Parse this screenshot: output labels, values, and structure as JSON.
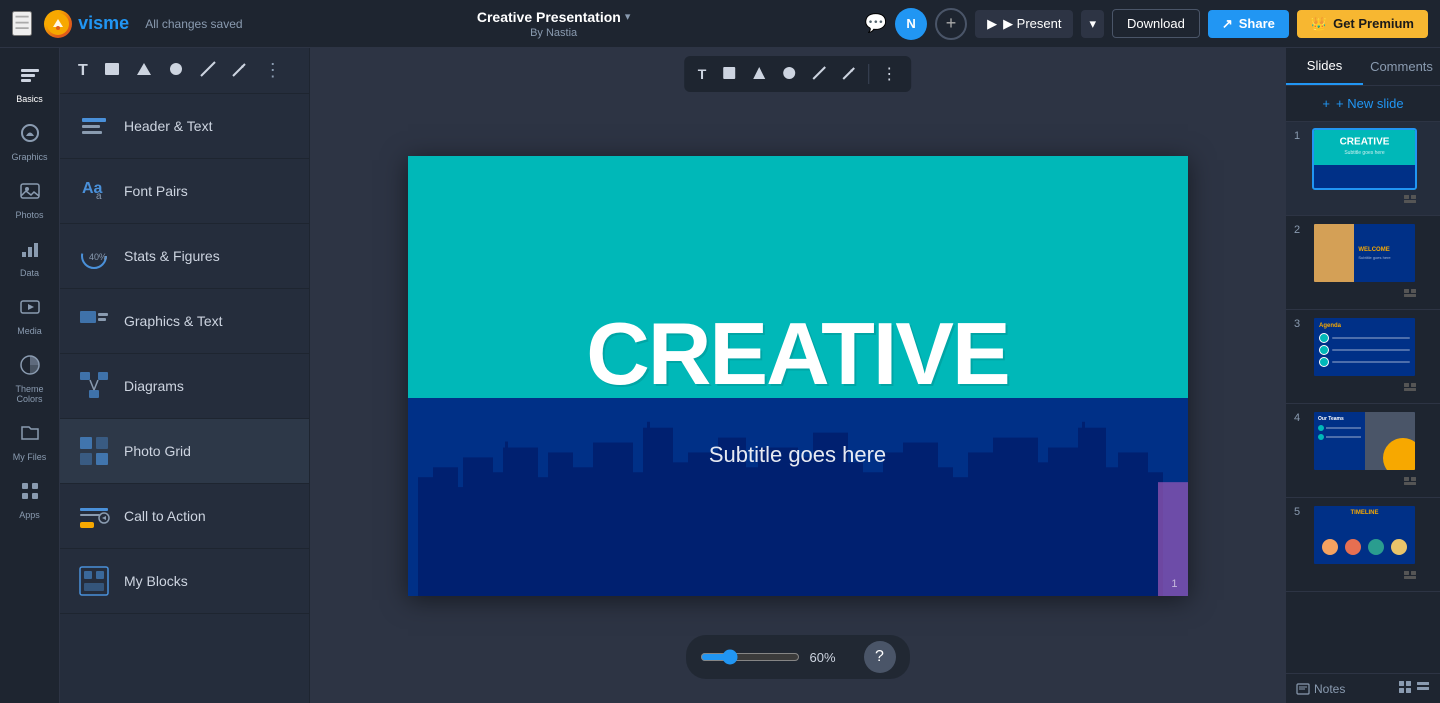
{
  "app": {
    "menu_icon": "☰",
    "logo_text": "visme",
    "saved_text": "All changes saved",
    "title": "Creative Presentation",
    "title_chevron": "▾",
    "subtitle": "By Nastia"
  },
  "topbar": {
    "comment_icon": "💬",
    "avatar_letter": "N",
    "add_icon": "+",
    "present_label": "▶  Present",
    "present_dropdown": "▾",
    "download_label": "Download",
    "share_label": "Share",
    "premium_label": "Get Premium",
    "premium_icon": "👑"
  },
  "toolbar": {
    "t_icon": "T",
    "rect_icon": "■",
    "tri_icon": "▲",
    "circ_icon": "●",
    "line_icon": "/",
    "arrow_icon": "↗",
    "more_icon": "⋮"
  },
  "sidebar": {
    "items": [
      {
        "id": "basics",
        "label": "Basics",
        "icon": "🔤"
      },
      {
        "id": "graphics",
        "label": "Graphics",
        "icon": "🎨"
      },
      {
        "id": "photos",
        "label": "Photos",
        "icon": "📷"
      },
      {
        "id": "data",
        "label": "Data",
        "icon": "📊"
      },
      {
        "id": "media",
        "label": "Media",
        "icon": "🎬"
      },
      {
        "id": "theme-colors",
        "label": "Theme Colors",
        "icon": "🎭"
      },
      {
        "id": "my-files",
        "label": "My Files",
        "icon": "📁"
      },
      {
        "id": "apps",
        "label": "Apps",
        "icon": "⚡"
      }
    ]
  },
  "panel": {
    "items": [
      {
        "id": "header-text",
        "label": "Header & Text"
      },
      {
        "id": "font-pairs",
        "label": "Font Pairs"
      },
      {
        "id": "stats-figures",
        "label": "Stats & Figures"
      },
      {
        "id": "graphics-text",
        "label": "Graphics & Text"
      },
      {
        "id": "diagrams",
        "label": "Diagrams"
      },
      {
        "id": "photo-grid",
        "label": "Photo Grid"
      },
      {
        "id": "call-to-action",
        "label": "Call to Action"
      },
      {
        "id": "my-blocks",
        "label": "My Blocks"
      }
    ]
  },
  "slide": {
    "creative_text": "CREATIVE",
    "subtitle_text": "Subtitle goes here",
    "number": "1"
  },
  "right_panel": {
    "tab_slides": "Slides",
    "tab_comments": "Comments",
    "new_slide_label": "+ New slide",
    "slides": [
      {
        "num": "1",
        "active": true
      },
      {
        "num": "2",
        "active": false
      },
      {
        "num": "3",
        "active": false
      },
      {
        "num": "4",
        "active": false
      },
      {
        "num": "5",
        "active": false
      }
    ]
  },
  "bottom": {
    "zoom_value": 60,
    "zoom_label": "60%",
    "notes_label": "Notes",
    "help_icon": "?",
    "grid_icon": "▦",
    "list_icon": "☰"
  },
  "colors": {
    "teal": "#00b8b8",
    "navy": "#003087",
    "orange": "#f7a800",
    "accent_blue": "#2196F3"
  }
}
